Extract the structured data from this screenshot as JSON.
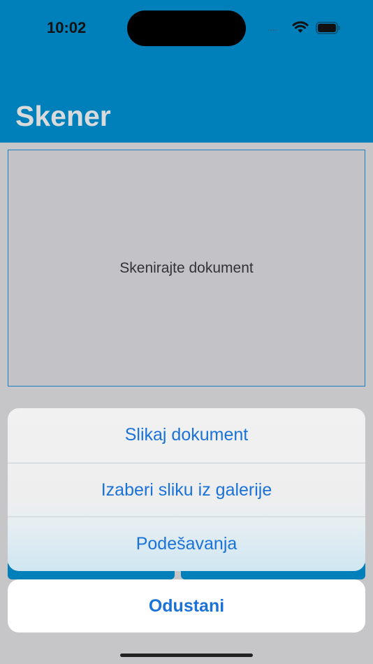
{
  "status_bar": {
    "time": "10:02",
    "signal_icon": "signal-dots-icon",
    "wifi_icon": "wifi-icon",
    "battery_icon": "battery-icon"
  },
  "nav": {
    "title": "Skener"
  },
  "scan_area": {
    "label": "Skenirajte dokument"
  },
  "action_sheet": {
    "items": [
      {
        "label": "Slikaj dokument"
      },
      {
        "label": "Izaberi sliku iz galerije"
      },
      {
        "label": "Podešavanja"
      }
    ],
    "cancel_label": "Odustani"
  },
  "colors": {
    "header_bg": "#0080ba",
    "accent": "#1a72d8",
    "background": "#c6c6c9"
  }
}
